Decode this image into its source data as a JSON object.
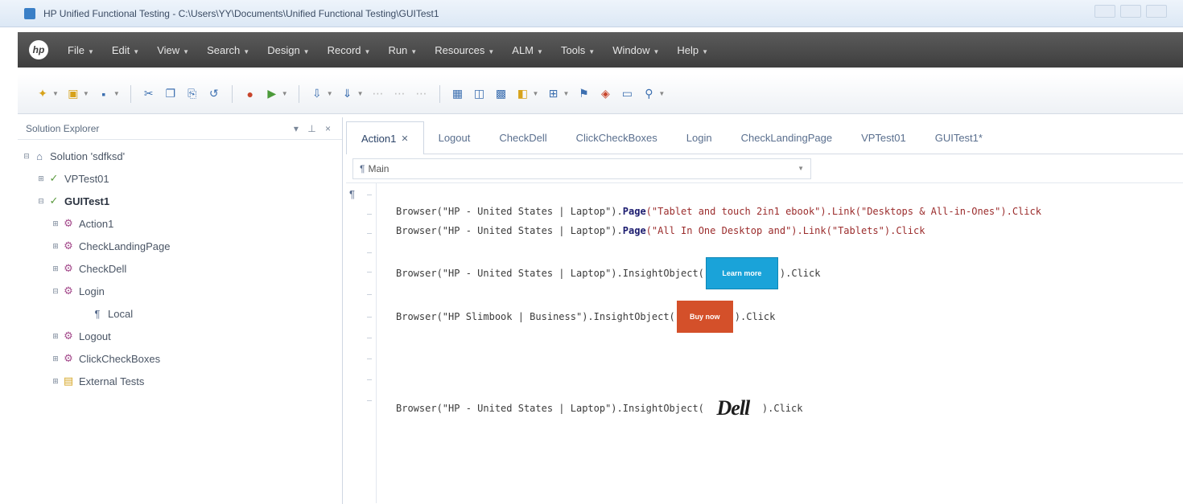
{
  "window": {
    "title": "HP Unified Functional Testing - C:\\Users\\YY\\Documents\\Unified Functional Testing\\GUITest1"
  },
  "menu": {
    "logo": "hp",
    "items": [
      "File",
      "Edit",
      "View",
      "Search",
      "Design",
      "Record",
      "Run",
      "Resources",
      "ALM",
      "Tools",
      "Window",
      "Help"
    ]
  },
  "explorer": {
    "title": "Solution Explorer",
    "controls": "▾ ⊥ ×",
    "nodes": [
      {
        "label": "Solution 'sdfksd'",
        "icon": "solution-icon",
        "glyph": "⌂",
        "level": 0,
        "bold": false
      },
      {
        "label": "VPTest01",
        "icon": "test-icon",
        "glyph": "✓",
        "level": 1,
        "bold": false
      },
      {
        "label": "GUITest1",
        "icon": "test-icon",
        "glyph": "✓",
        "level": 1,
        "bold": true
      },
      {
        "label": "Action1",
        "icon": "action-icon",
        "glyph": "⚙",
        "level": 2,
        "bold": false
      },
      {
        "label": "CheckLandingPage",
        "icon": "action-icon",
        "glyph": "⚙",
        "level": 2,
        "bold": false
      },
      {
        "label": "CheckDell",
        "icon": "action-icon",
        "glyph": "⚙",
        "level": 2,
        "bold": false
      },
      {
        "label": "Login",
        "icon": "action-icon",
        "glyph": "⚙",
        "level": 2,
        "bold": false
      },
      {
        "label": "Local",
        "icon": "object-repository-icon",
        "glyph": "¶",
        "level": 3,
        "bold": false
      },
      {
        "label": "Logout",
        "icon": "action-icon",
        "glyph": "⚙",
        "level": 2,
        "bold": false
      },
      {
        "label": "ClickCheckBoxes",
        "icon": "action-icon",
        "glyph": "⚙",
        "level": 2,
        "bold": false
      },
      {
        "label": "External Tests",
        "icon": "folder-icon",
        "glyph": "▤",
        "level": 2,
        "bold": false
      }
    ]
  },
  "editor": {
    "tabs": [
      {
        "label": "Action1",
        "active": true,
        "closable": true
      },
      {
        "label": "Logout",
        "active": false
      },
      {
        "label": "CheckDell",
        "active": false
      },
      {
        "label": "ClickCheckBoxes",
        "active": false
      },
      {
        "label": "Login",
        "active": false
      },
      {
        "label": "CheckLandingPage",
        "active": false
      },
      {
        "label": "VPTest01",
        "active": false
      },
      {
        "label": "GUITest1*",
        "active": false
      }
    ],
    "location": "Main",
    "code": {
      "line1": {
        "prefix": "Browser(\"HP - United States | Laptop\").",
        "kw": "Page",
        "str": "(\"Tablet and touch 2in1 ebook\").Link(\"Desktops & All-in-Ones\").Click",
        "suffix": ""
      },
      "line2": {
        "prefix": "Browser(\"HP - United States | Laptop\").",
        "kw": "Page",
        "str": "(\"All In One Desktop and\").Link(\"Tablets\").Click",
        "suffix": ""
      },
      "line3": {
        "prefix": "Browser(\"HP - United States | Laptop\").InsightObject(",
        "image": "Learn more",
        "suffix": ").Click"
      },
      "line4": {
        "prefix": "Browser(\"HP Slimbook | Business\").InsightObject(",
        "image": "Buy now",
        "suffix": ").Click"
      },
      "line5": {
        "prefix": "Browser(\"HP - United States | Laptop\").InsightObject(",
        "image": "Dell",
        "suffix": ").Click"
      }
    }
  }
}
